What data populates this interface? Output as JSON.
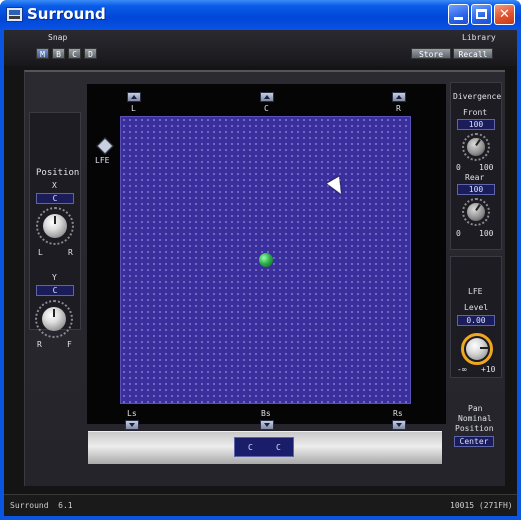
{
  "window": {
    "title": "Surround"
  },
  "snap": {
    "label": "Snap",
    "buttons": [
      "M",
      "B",
      "C",
      "D"
    ]
  },
  "library": {
    "label": "Library",
    "store": "Store",
    "recall": "Recall"
  },
  "position": {
    "title": "Position",
    "x_label": "X",
    "x_value": "C",
    "x_left": "L",
    "x_right": "R",
    "y_label": "Y",
    "y_value": "C",
    "y_left": "R",
    "y_right": "F"
  },
  "speakers": {
    "l": "L",
    "c": "C",
    "r": "R",
    "lfe": "LFE",
    "ls": "Ls",
    "bs": "Bs",
    "rs": "Rs"
  },
  "pan_readout": {
    "x": "C",
    "y": "C"
  },
  "divergence": {
    "title": "Divergence",
    "front_label": "Front",
    "front_value": "100",
    "front_min": "0",
    "front_max": "100",
    "rear_label": "Rear",
    "rear_value": "100",
    "rear_min": "0",
    "rear_max": "100"
  },
  "lfe": {
    "title": "LFE",
    "level_label": "Level",
    "level_value": "0.00",
    "min": "-∞",
    "max": "+10"
  },
  "pan_nominal": {
    "line1": "Pan",
    "line2": "Nominal",
    "line3": "Position",
    "value": "Center"
  },
  "status": {
    "left": "Surround  6.1",
    "right": "10015 (271FH)"
  }
}
